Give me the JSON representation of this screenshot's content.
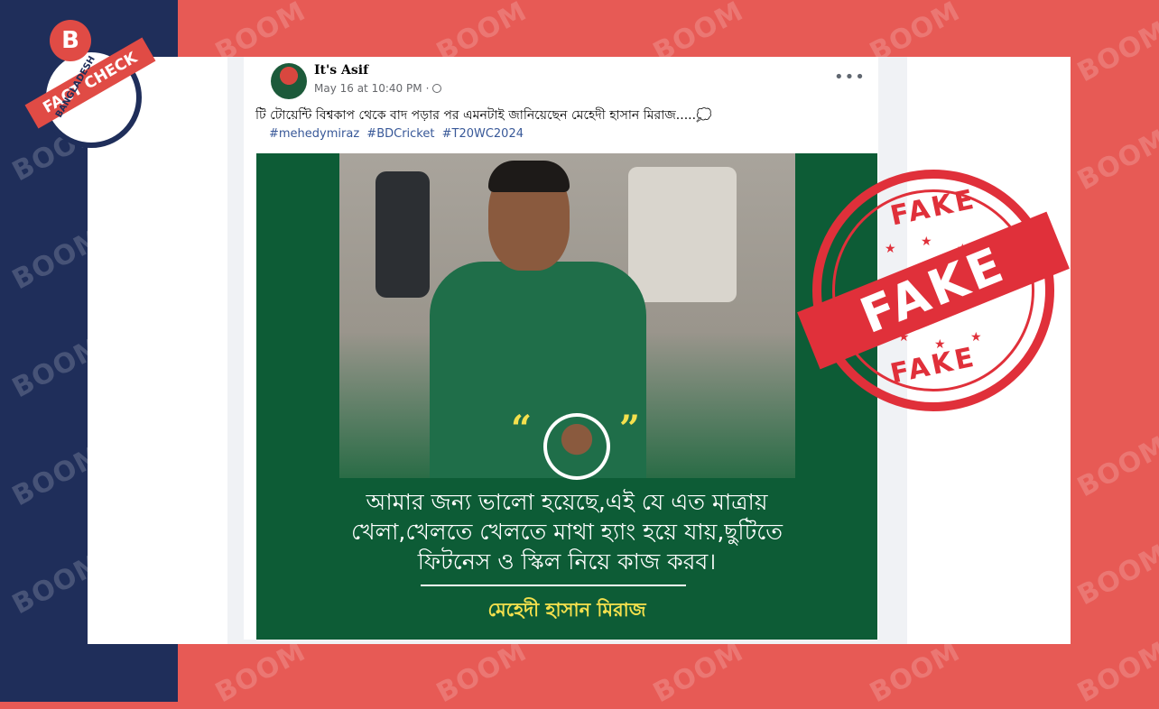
{
  "watermark": {
    "text": "BOOM"
  },
  "badge": {
    "letter": "B",
    "ribbon": "FACT CHECK",
    "country": "BANGLADESH"
  },
  "post": {
    "author": "It's Asif",
    "timestamp": "May 16 at 10:40 PM",
    "separator": "·",
    "more_icon": "more-horizontal-icon",
    "caption": "টি টোয়েন্টি বিশ্বকাপ থেকে বাদ পড়ার পর এমনটাই জানিয়েছেন মেহেদী হাসান মিরাজ.....💭",
    "hashtags": [
      "#mehedymiraz",
      "#BDCricket",
      "#T20WC2024"
    ]
  },
  "image": {
    "quote_open": "“",
    "quote_close": "”",
    "quote_lines": [
      "আমার জন্য ভালো হয়েছে,এই যে এত মাত্রায়",
      "খেলা,খেলতে খেলতে মাথা হ্যাং হয়ে যায়,ছুটিতে",
      "ফিটনেস ও স্কিল নিয়ে কাজ করব।"
    ],
    "quote_author": "মেহেদী হাসান মিরাজ"
  },
  "stamp": {
    "top": "FAKE",
    "center": "FAKE",
    "bottom": "FAKE",
    "color": "#e0303a"
  },
  "colors": {
    "background_red": "#e75a55",
    "navy": "#1f2e5a",
    "image_green": "#0d5c36",
    "hashtag_blue": "#385898",
    "quote_yellow": "#f4e04d"
  }
}
